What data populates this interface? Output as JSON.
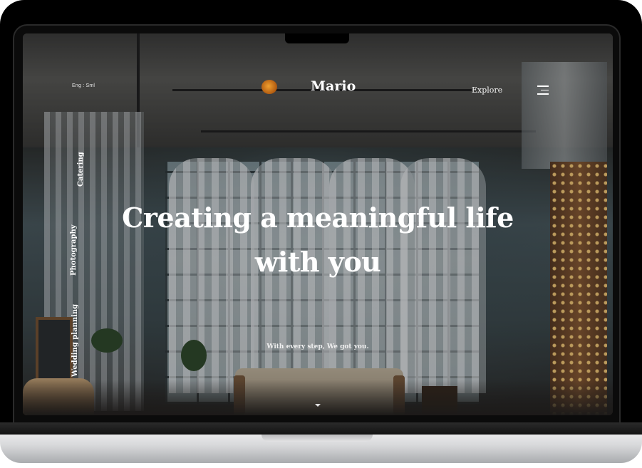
{
  "header": {
    "language": "Eng : Sml",
    "brand": "Mario",
    "explore_label": "Explore",
    "menu_icon": "hamburger-menu-icon",
    "logo_icon": "brand-logo-icon"
  },
  "side_nav": {
    "items": [
      {
        "label": "Catering"
      },
      {
        "label": "Photography"
      },
      {
        "label": "Wedding planning"
      }
    ]
  },
  "hero": {
    "title_line1": "Creating a meaningful life",
    "title_line2": "with you",
    "subtitle": "With every step, We got you.",
    "scroll_icon": "chevron-down-icon"
  },
  "colors": {
    "text": "#ffffff",
    "logo_accent": "#e8901e",
    "laptop_silver": "#d6d7d9"
  }
}
